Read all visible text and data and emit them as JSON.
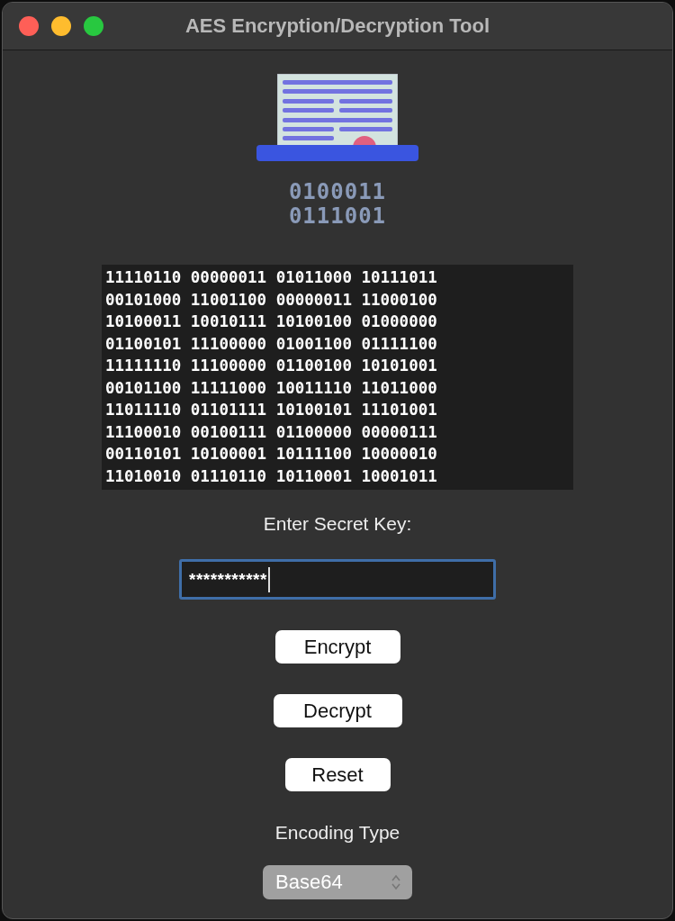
{
  "window": {
    "title": "AES Encryption/Decryption Tool"
  },
  "logo": {
    "binary_lines": [
      "0100011",
      "0111001"
    ]
  },
  "output": {
    "lines": [
      "11110110 00000011 01011000 10111011",
      "00101000 11001100 00000011 11000100",
      "10100011 10010111 10100100 01000000",
      "01100101 11100000 01001100 01111100",
      "11111110 11100000 01100100 10101001",
      "00101100 11111000 10011110 11011000",
      "11011110 01101111 10100101 11101001",
      "11100010 00100111 01100000 00000111",
      "00110101 10100001 10111100 10000010",
      "11010010 01110110 10110001 10001011"
    ]
  },
  "key": {
    "label": "Enter Secret Key:",
    "value": "***********"
  },
  "buttons": [
    "Encrypt",
    "Decrypt",
    "Reset"
  ],
  "encoding": {
    "label": "Encoding Type",
    "value": "Base64"
  }
}
